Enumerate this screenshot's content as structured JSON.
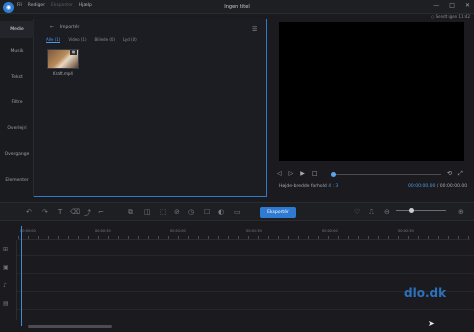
{
  "titlebar": {
    "logo_glyph": "◉",
    "menu": [
      "Fil",
      "Rediger",
      "Eksporter",
      "Hjælp"
    ],
    "title": "Ingen titel",
    "controls": [
      "—",
      "□",
      "✕"
    ],
    "signin": "○ Sendt igen 11:42"
  },
  "leftnav": {
    "items": [
      "Medie",
      "Musik",
      "Tekst",
      "Filtre",
      "Overlejri",
      "Overgange",
      "Elementer"
    ]
  },
  "media": {
    "import_arrow": "←",
    "import_label": "Importér",
    "filters": [
      "Alle (1)",
      "Video (1)",
      "Billede (0)",
      "Lyd (0)"
    ],
    "item_label": "Kraft.mp4",
    "item_badge": "▦",
    "panel_icon": "☰"
  },
  "preview": {
    "aspect_label": "Højde-bredde forhold",
    "aspect_value": "4 : 3",
    "current_time": "00:00:00.00",
    "separator": "/",
    "total_time": "00:00:00.00",
    "controls": [
      "◁",
      "▷",
      "▶",
      "□"
    ],
    "right_controls": [
      "⟲",
      "⤢"
    ]
  },
  "toolbar": {
    "tools": [
      "↶",
      "↷",
      "T",
      "⌫",
      "⤴",
      "⌐",
      "⧉",
      "◫",
      "⬚",
      "⊘",
      "◷",
      "☐",
      "◐",
      "▭"
    ],
    "export_label": "Eksportér",
    "right_tools": [
      "♡",
      "⎍",
      "⊖",
      "⊕"
    ]
  },
  "timeline": {
    "ruler_labels": [
      "00:00:00",
      "00:00:30",
      "00:01:00",
      "00:01:30",
      "00:02:00",
      "00:02:30"
    ],
    "track_icons": [
      "⊞",
      "▣",
      "♪",
      "▤"
    ]
  },
  "watermark": "dlo.dk",
  "cursor": "➤"
}
